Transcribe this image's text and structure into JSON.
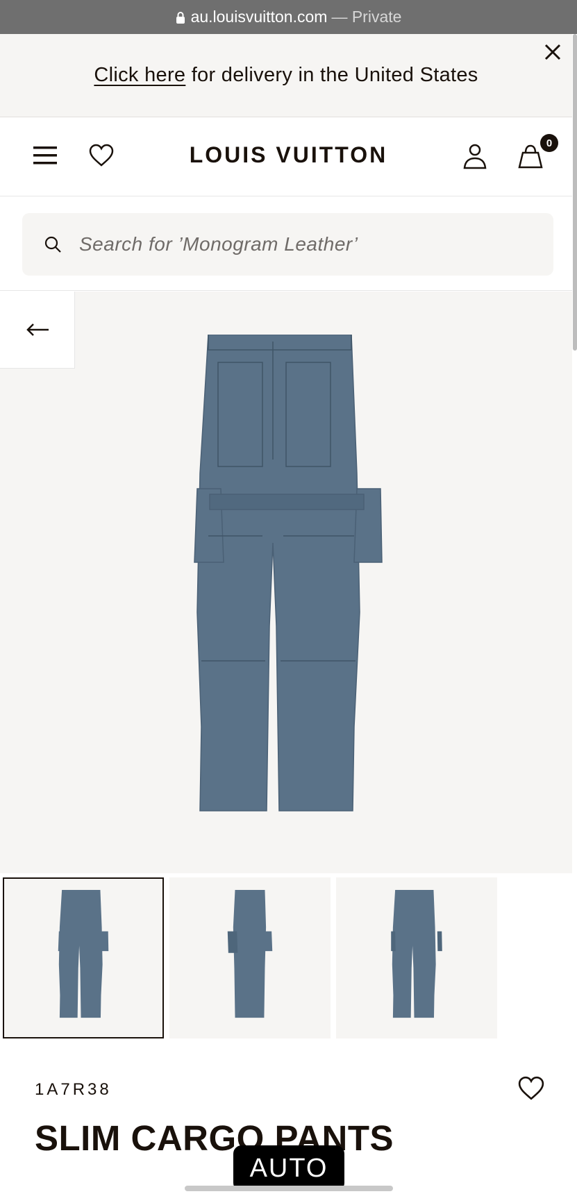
{
  "browser": {
    "url": "au.louisvuitton.com",
    "mode": "— Private"
  },
  "banner": {
    "link_text": "Click here",
    "rest_text": " for delivery in the United States"
  },
  "header": {
    "logo": "LOUIS VUITTON",
    "bag_count": "0"
  },
  "search": {
    "placeholder": "Search for ’Monogram Leather’"
  },
  "product": {
    "sku": "1A7R38",
    "title": "SLIM CARGO PANTS",
    "color": "#5a7288"
  },
  "overlay": {
    "auto_label": "AUTO"
  },
  "icons": [
    "lock-icon",
    "close-icon",
    "menu-icon",
    "heart-icon",
    "user-icon",
    "bag-icon",
    "search-icon",
    "arrow-left-icon"
  ]
}
